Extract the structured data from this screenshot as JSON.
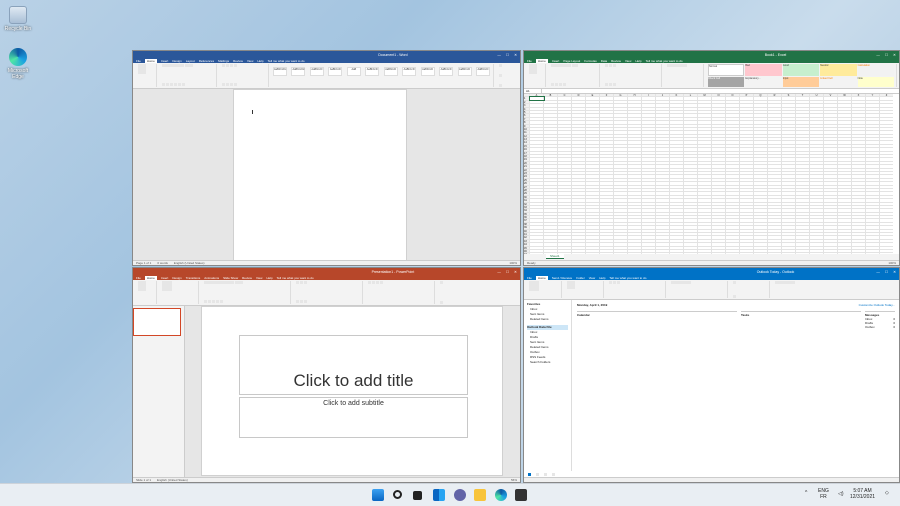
{
  "desktop": {
    "recycle_bin": "Recycle Bin",
    "edge": "Microsoft Edge"
  },
  "word": {
    "title": "Document1 - Word",
    "menu": [
      "File",
      "Home",
      "Insert",
      "Design",
      "Layout",
      "References",
      "Mailings",
      "Review",
      "View",
      "Help"
    ],
    "tell_me": "Tell me what you want to do",
    "styles": [
      "AaBbCcDc",
      "AaBbCcDc",
      "AaBbCcD",
      "AaBbCcD",
      "AaB",
      "AaBbCcD",
      "AaBbCcD",
      "AaBbCcD",
      "AaBbCcD",
      "AaBbCcD",
      "AaBbCcD",
      "AaBbCcD"
    ],
    "status_page": "Page 1 of 1",
    "status_words": "0 words",
    "status_lang": "English (United States)",
    "zoom": "100%"
  },
  "excel": {
    "title": "Book1 - Excel",
    "menu": [
      "File",
      "Home",
      "Insert",
      "Page Layout",
      "Formulas",
      "Data",
      "Review",
      "View",
      "Help"
    ],
    "tell_me": "Tell me what you want to do",
    "name_box": "A1",
    "sheet_tab": "Sheet1",
    "cells": [
      "Normal",
      "Bad",
      "Good",
      "Neutral",
      "Calculation",
      "Check Cell",
      "Explanatory...",
      "Input",
      "Linked Cell",
      "Note"
    ],
    "columns": [
      "A",
      "B",
      "C",
      "D",
      "E",
      "F",
      "G",
      "H",
      "I",
      "J",
      "K",
      "L",
      "M",
      "N",
      "O",
      "P",
      "Q",
      "R",
      "S",
      "T",
      "U",
      "V",
      "W",
      "X",
      "Y",
      "Z"
    ],
    "rows": [
      "1",
      "2",
      "3",
      "4",
      "5",
      "6",
      "7",
      "8",
      "9",
      "10",
      "11",
      "12",
      "13",
      "14",
      "15",
      "16",
      "17",
      "18",
      "19",
      "20",
      "21",
      "22",
      "23",
      "24",
      "25",
      "26",
      "27",
      "28",
      "29",
      "30",
      "31",
      "32",
      "33",
      "34",
      "35",
      "36",
      "37",
      "38",
      "39",
      "40",
      "41",
      "42",
      "43",
      "44",
      "45",
      "46",
      "47"
    ],
    "status": "Ready",
    "zoom": "100%"
  },
  "powerpoint": {
    "title": "Presentation1 - PowerPoint",
    "menu": [
      "File",
      "Home",
      "Insert",
      "Design",
      "Transitions",
      "Animations",
      "Slide Show",
      "Review",
      "View",
      "Help"
    ],
    "tell_me": "Tell me what you want to do",
    "slide_number": "1",
    "title_placeholder": "Click to add title",
    "subtitle_placeholder": "Click to add subtitle",
    "status_slide": "Slide 1 of 1",
    "status_lang": "English (United States)",
    "zoom": "56%"
  },
  "outlook": {
    "title": "Outlook Today - Outlook",
    "menu": [
      "File",
      "Home",
      "Send / Receive",
      "Folder",
      "View",
      "Help"
    ],
    "tell_me": "Tell me what you want to do",
    "nav_favorites": "Favorites",
    "nav_items": [
      "Inbox",
      "Sent Items",
      "Deleted Items"
    ],
    "folder_header": "Outlook Data File",
    "folder_items": [
      "Inbox",
      "Drafts",
      "Sent Items",
      "Deleted Items",
      "Outbox",
      "RSS Feeds",
      "Search Folders"
    ],
    "date": "Monday, April 1, 2019",
    "col_calendar": "Calendar",
    "col_tasks": "Tasks",
    "col_messages": "Messages",
    "customize": "Customize Outlook Today...",
    "messages": [
      {
        "label": "Inbox",
        "count": "0"
      },
      {
        "label": "Drafts",
        "count": "0"
      },
      {
        "label": "Outbox",
        "count": "0"
      }
    ]
  },
  "taskbar": {
    "lang_top": "ENG",
    "lang_bottom": "FR",
    "time": "5:07 AM",
    "date": "12/31/2021"
  },
  "colors": {
    "word": "#2b579a",
    "excel": "#217346",
    "powerpoint": "#b7472a",
    "outlook": "#0072c6"
  }
}
